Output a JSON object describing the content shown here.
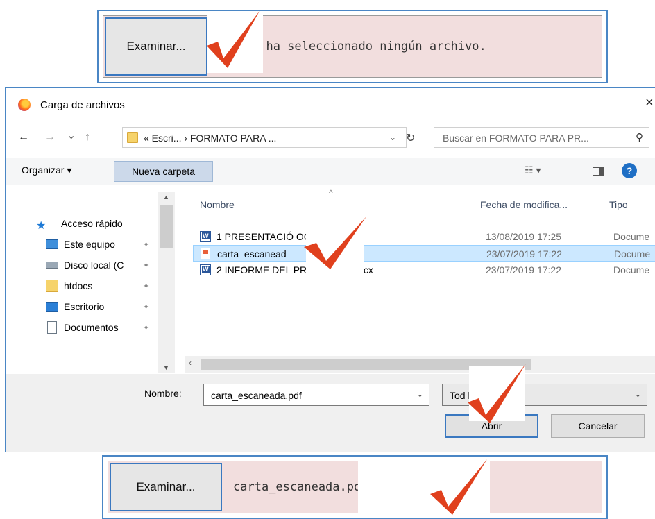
{
  "top_widget": {
    "browse_label": "Examinar...",
    "status_text": "e ha seleccionado ningún archivo."
  },
  "dialog": {
    "title": "Carga de archivos",
    "close_glyph": "×",
    "nav": {
      "back": "←",
      "forward": "→",
      "history": "⌄",
      "up": "↑"
    },
    "address": "« Escri... › FORMATO PARA ...",
    "address_dropdown": "⌄",
    "refresh": "↻",
    "search_placeholder": "Buscar en FORMATO PARA PR...",
    "search_glyph": "⚲",
    "toolbar": {
      "organize": "Organizar ▾",
      "new_folder": "Nueva carpeta",
      "view": "☷ ▾",
      "help": "?"
    },
    "nav_pane": [
      {
        "label": "Acceso rápido",
        "icon": "star-icon",
        "pinned": false
      },
      {
        "label": "Este equipo",
        "icon": "computer-icon",
        "pinned": true
      },
      {
        "label": "Disco local (C",
        "icon": "drive-icon",
        "pinned": true
      },
      {
        "label": "htdocs",
        "icon": "folder-icon",
        "pinned": true
      },
      {
        "label": "Escritorio",
        "icon": "desktop-icon",
        "pinned": true
      },
      {
        "label": "Documentos",
        "icon": "documents-icon",
        "pinned": true
      }
    ],
    "columns": {
      "name": "Nombre",
      "date": "Fecha de modifica...",
      "type": "Tipo"
    },
    "files": [
      {
        "name": "1 PRESENTACIÓ                OGRAMA.docx",
        "date": "13/08/2019 17:25",
        "type": "Docume",
        "icon": "word-doc-icon",
        "selected": false
      },
      {
        "name": "carta_escanead",
        "date": "23/07/2019 17:22",
        "type": "Docume",
        "icon": "pdf-file-icon",
        "selected": true
      },
      {
        "name": "2 INFORME DEL PROGRAMA.docx",
        "date": "23/07/2019 17:22",
        "type": "Docume",
        "icon": "word-doc-icon",
        "selected": false
      }
    ],
    "footer": {
      "filename_label": "Nombre:",
      "filename_value": "carta_escaneada.pdf",
      "filetype_value": "Tod            hivos (*.*)",
      "open_button": "Abrir",
      "cancel_button": "Cancelar"
    }
  },
  "bottom_widget": {
    "browse_label": "Examinar...",
    "status_text": "carta_escaneada.pdf"
  },
  "colors": {
    "check_red": "#e0401d",
    "selection": "#cce8ff",
    "accent_blue": "#3a78c0",
    "file_field_bg": "#f2dede"
  }
}
